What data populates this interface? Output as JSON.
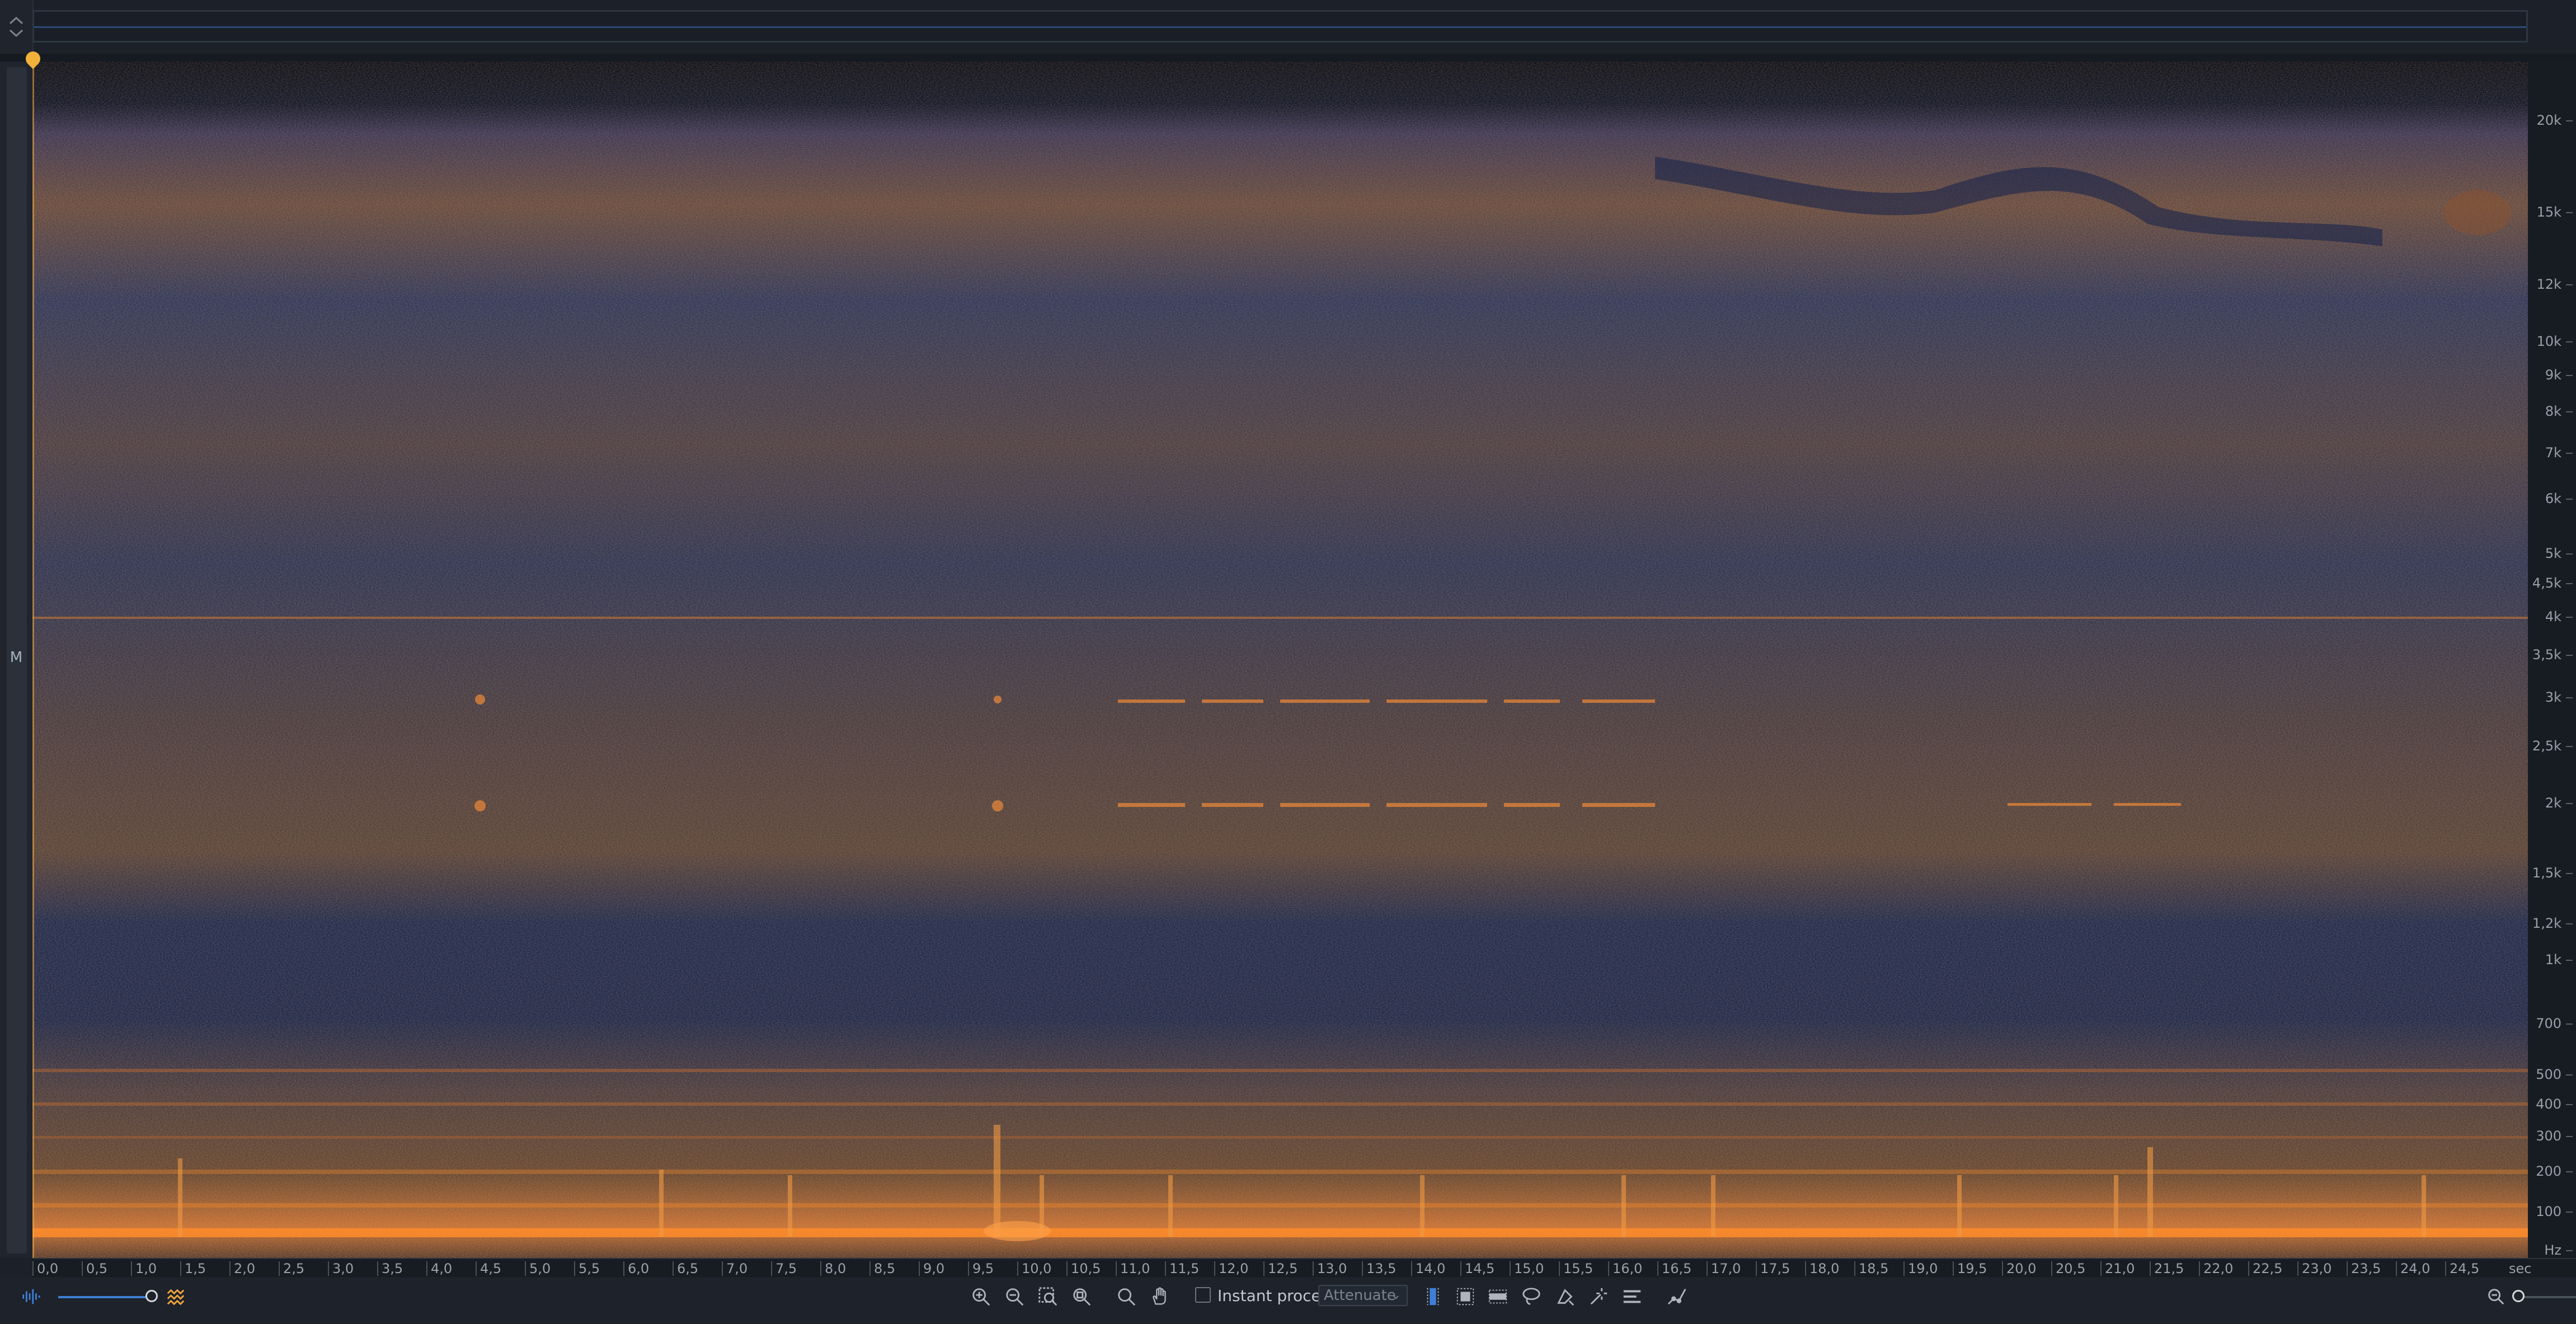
{
  "channel": {
    "label": "M"
  },
  "frequency_axis": {
    "unit": "Hz",
    "ticks": [
      "20k",
      "15k",
      "12k",
      "10k",
      "9k",
      "8k",
      "7k",
      "6k",
      "5k",
      "4,5k",
      "4k",
      "3,5k",
      "3k",
      "2,5k",
      "2k",
      "1,5k",
      "1,2k",
      "1k",
      "700",
      "500",
      "400",
      "300",
      "200",
      "100"
    ]
  },
  "time_axis": {
    "unit": "sec",
    "ticks": [
      "0,0",
      "0,5",
      "1,0",
      "1,5",
      "2,0",
      "2,5",
      "3,0",
      "3,5",
      "4,0",
      "4,5",
      "5,0",
      "5,5",
      "6,0",
      "6,5",
      "7,0",
      "7,5",
      "8,0",
      "8,5",
      "9,0",
      "9,5",
      "10,0",
      "10,5",
      "11,0",
      "11,5",
      "12,0",
      "12,5",
      "13,0",
      "13,5",
      "14,0",
      "14,5",
      "15,0",
      "15,5",
      "16,0",
      "16,5",
      "17,0",
      "17,5",
      "18,0",
      "18,5",
      "19,0",
      "19,5",
      "20,0",
      "20,5",
      "21,0",
      "21,5",
      "22,0",
      "22,5",
      "23,0",
      "23,5",
      "24,0",
      "24,5"
    ]
  },
  "toolbar": {
    "instant_process_label": "Instant process",
    "instant_process_checked": false,
    "mode_value": "Attenuate",
    "icons": [
      "waveform-icon",
      "spectrogram-icon",
      "zoom-in-icon",
      "zoom-out-icon",
      "zoom-selection-icon",
      "zoom-fit-icon",
      "magnifier-icon",
      "hand-icon",
      "time-selection-icon",
      "rect-selection-icon",
      "freq-selection-icon",
      "lasso-icon",
      "brush-icon",
      "magic-wand-icon",
      "harmonic-selection-icon",
      "envelope-icon",
      "zoom-out-small-icon"
    ]
  },
  "colors": {
    "spectrogram_low": "#0d1a35",
    "spectrogram_mid": "#5a4a3a",
    "spectrogram_high": "#ff8c2a",
    "playhead": "#f2b23a",
    "accent": "#3f7fd6"
  }
}
